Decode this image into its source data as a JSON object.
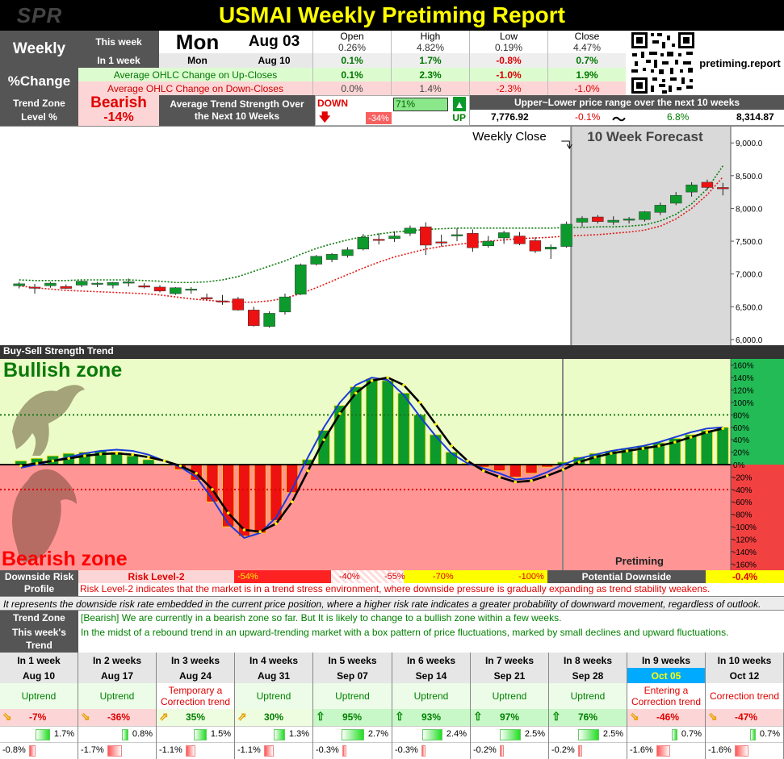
{
  "title": "USMAI Weekly Pretiming Report",
  "logo": "SPR",
  "header": {
    "weekly_label": "Weekly",
    "pct_change_label": "%Change",
    "this_week_label": "This week",
    "in1week_label": "In 1 week",
    "day": "Mon",
    "date": "Aug 03",
    "next_day": "Mon",
    "next_date": "Aug 10",
    "cols": [
      "Open",
      "High",
      "Low",
      "Close"
    ],
    "this_week_values": [
      "0.26%",
      "4.82%",
      "0.19%",
      "4.47%"
    ],
    "in1week_values": [
      "0.1%",
      "1.7%",
      "-0.8%",
      "0.7%"
    ],
    "up_label": "Average OHLC Change on Up-Closes",
    "up_values": [
      "0.1%",
      "2.3%",
      "-1.0%",
      "1.9%"
    ],
    "down_label": "Average OHLC Change on Down-Closes",
    "down_values": [
      "0.0%",
      "1.4%",
      "-2.3%",
      "-1.0%"
    ],
    "site": "pretiming.report"
  },
  "trend_zone": {
    "label1": "Trend Zone",
    "label2": "Level %",
    "state": "Bearish",
    "level": "-14%",
    "strength_label": "Average Trend Strength Over the Next 10 Weeks",
    "down_label": "DOWN",
    "down_value": "-34%",
    "up_value": "71%",
    "up_label": "UP",
    "range_label": "Upper~Lower price range over the next 10 weeks",
    "range_low": "7,776.92",
    "range_low_pct": "-0.1%",
    "tilde": "〜",
    "range_high_pct": "6.8%",
    "range_high": "8,314.87"
  },
  "price_chart": {
    "weekly_close_label": "Weekly Close",
    "forecast_label": "10 Week Forecast",
    "y_ticks": [
      "9,000.0",
      "8,500.0",
      "8,000.0",
      "7,500.0",
      "7,000.0",
      "6,500.0",
      "6,000.0"
    ]
  },
  "strength_chart": {
    "section_title": "Buy-Sell Strength Trend",
    "bull_label": "Bullish zone",
    "bear_label": "Bearish zone",
    "brand": "Pretiming",
    "y_ticks": [
      "160%",
      "140%",
      "120%",
      "100%",
      "80%",
      "60%",
      "40%",
      "20%",
      "0%",
      "-20%",
      "-40%",
      "-60%",
      "-80%",
      "-100%",
      "-120%",
      "-140%",
      "-160%"
    ]
  },
  "chart_data": [
    {
      "type": "candlestick",
      "title": "",
      "ylim": [
        5950,
        9150
      ],
      "candles": [
        {
          "o": 6820,
          "h": 6880,
          "l": 6780,
          "c": 6850
        },
        {
          "o": 6800,
          "h": 6850,
          "l": 6700,
          "c": 6790
        },
        {
          "o": 6820,
          "h": 6880,
          "l": 6790,
          "c": 6860
        },
        {
          "o": 6810,
          "h": 6840,
          "l": 6770,
          "c": 6780
        },
        {
          "o": 6830,
          "h": 6900,
          "l": 6800,
          "c": 6890
        },
        {
          "o": 6850,
          "h": 6880,
          "l": 6800,
          "c": 6860
        },
        {
          "o": 6830,
          "h": 6880,
          "l": 6780,
          "c": 6870
        },
        {
          "o": 6860,
          "h": 6930,
          "l": 6810,
          "c": 6880
        },
        {
          "o": 6820,
          "h": 6860,
          "l": 6780,
          "c": 6800
        },
        {
          "o": 6800,
          "h": 6830,
          "l": 6720,
          "c": 6740
        },
        {
          "o": 6700,
          "h": 6800,
          "l": 6680,
          "c": 6790
        },
        {
          "o": 6760,
          "h": 6800,
          "l": 6700,
          "c": 6770
        },
        {
          "o": 6640,
          "h": 6700,
          "l": 6600,
          "c": 6620
        },
        {
          "o": 6590,
          "h": 6680,
          "l": 6530,
          "c": 6580
        },
        {
          "o": 6620,
          "h": 6650,
          "l": 6440,
          "c": 6450
        },
        {
          "o": 6450,
          "h": 6500,
          "l": 6200,
          "c": 6210
        },
        {
          "o": 6200,
          "h": 6430,
          "l": 6180,
          "c": 6400
        },
        {
          "o": 6420,
          "h": 6700,
          "l": 6380,
          "c": 6650
        },
        {
          "o": 6690,
          "h": 7160,
          "l": 6680,
          "c": 7140
        },
        {
          "o": 7150,
          "h": 7290,
          "l": 7130,
          "c": 7270
        },
        {
          "o": 7220,
          "h": 7320,
          "l": 7180,
          "c": 7300
        },
        {
          "o": 7280,
          "h": 7410,
          "l": 7250,
          "c": 7370
        },
        {
          "o": 7380,
          "h": 7610,
          "l": 7360,
          "c": 7560
        },
        {
          "o": 7530,
          "h": 7620,
          "l": 7450,
          "c": 7520
        },
        {
          "o": 7540,
          "h": 7650,
          "l": 7490,
          "c": 7580
        },
        {
          "o": 7620,
          "h": 7740,
          "l": 7580,
          "c": 7700
        },
        {
          "o": 7720,
          "h": 7790,
          "l": 7290,
          "c": 7440
        },
        {
          "o": 7490,
          "h": 7600,
          "l": 7420,
          "c": 7480
        },
        {
          "o": 7580,
          "h": 7700,
          "l": 7500,
          "c": 7600
        },
        {
          "o": 7620,
          "h": 7680,
          "l": 7340,
          "c": 7400
        },
        {
          "o": 7430,
          "h": 7580,
          "l": 7400,
          "c": 7500
        },
        {
          "o": 7550,
          "h": 7660,
          "l": 7460,
          "c": 7630
        },
        {
          "o": 7580,
          "h": 7640,
          "l": 7440,
          "c": 7460
        },
        {
          "o": 7510,
          "h": 7560,
          "l": 7320,
          "c": 7350
        },
        {
          "o": 7380,
          "h": 7450,
          "l": 7230,
          "c": 7410
        },
        {
          "o": 7420,
          "h": 7800,
          "l": 7400,
          "c": 7760
        },
        {
          "o": 7790,
          "h": 7880,
          "l": 7720,
          "c": 7850
        },
        {
          "o": 7870,
          "h": 7900,
          "l": 7770,
          "c": 7800
        },
        {
          "o": 7790,
          "h": 7880,
          "l": 7750,
          "c": 7820
        },
        {
          "o": 7820,
          "h": 7870,
          "l": 7770,
          "c": 7840
        },
        {
          "o": 7830,
          "h": 7960,
          "l": 7800,
          "c": 7950
        },
        {
          "o": 7940,
          "h": 8090,
          "l": 7900,
          "c": 8050
        },
        {
          "o": 8080,
          "h": 8250,
          "l": 8050,
          "c": 8200
        },
        {
          "o": 8250,
          "h": 8400,
          "l": 8180,
          "c": 8360
        },
        {
          "o": 8400,
          "h": 8440,
          "l": 8280,
          "c": 8320
        },
        {
          "o": 8320,
          "h": 8390,
          "l": 8200,
          "c": 8300
        }
      ],
      "forecast_start_index": 36,
      "upper_band": [
        6910,
        6900,
        6900,
        6900,
        6910,
        6910,
        6910,
        6910,
        6900,
        6890,
        6870,
        6870,
        6880,
        6910,
        6960,
        7040,
        7120,
        7200,
        7300,
        7390,
        7460,
        7520,
        7570,
        7610,
        7640,
        7660,
        7680,
        7690,
        7700,
        7700,
        7700,
        7700,
        7700,
        7700,
        7700,
        7710,
        7710,
        7720,
        7720,
        7730,
        7750,
        7810,
        7910,
        8070,
        8300,
        8650
      ],
      "lower_band": [
        6820,
        6790,
        6770,
        6750,
        6740,
        6730,
        6720,
        6710,
        6700,
        6680,
        6650,
        6620,
        6600,
        6580,
        6570,
        6570,
        6590,
        6630,
        6700,
        6790,
        6890,
        6990,
        7090,
        7180,
        7260,
        7320,
        7380,
        7420,
        7450,
        7480,
        7500,
        7520,
        7540,
        7550,
        7560,
        7580,
        7590,
        7600,
        7620,
        7640,
        7670,
        7730,
        7840,
        8000,
        8210,
        8480
      ]
    },
    {
      "type": "bar",
      "title": "Buy-Sell Strength Trend",
      "ylim": [
        -170,
        170
      ],
      "values": [
        6,
        10,
        14,
        18,
        20,
        22,
        20,
        14,
        8,
        0,
        -8,
        -25,
        -60,
        -100,
        -115,
        -110,
        -90,
        -45,
        8,
        55,
        95,
        125,
        138,
        135,
        115,
        80,
        48,
        20,
        2,
        -4,
        -10,
        -20,
        -14,
        -4,
        4,
        12,
        18,
        22,
        26,
        30,
        35,
        42,
        48,
        55,
        60
      ],
      "series": [
        {
          "name": "",
          "values": [
            -5,
            0,
            6,
            12,
            18,
            22,
            24,
            22,
            16,
            6,
            -4,
            -20,
            -55,
            -95,
            -118,
            -110,
            -85,
            -40,
            12,
            60,
            100,
            128,
            140,
            136,
            112,
            78,
            46,
            18,
            2,
            -6,
            -14,
            -24,
            -22,
            -12,
            0,
            10,
            16,
            22,
            26,
            30,
            36,
            44,
            52,
            58,
            60
          ]
        },
        {
          "name": "",
          "values": [
            -2,
            2,
            6,
            10,
            14,
            17,
            18,
            16,
            12,
            6,
            -2,
            -14,
            -40,
            -78,
            -105,
            -108,
            -95,
            -60,
            -10,
            40,
            82,
            115,
            135,
            140,
            128,
            100,
            65,
            30,
            6,
            -10,
            -20,
            -28,
            -26,
            -18,
            -8,
            4,
            12,
            18,
            22,
            26,
            30,
            36,
            44,
            52,
            58
          ]
        }
      ],
      "hlines": [
        80,
        -40
      ]
    }
  ],
  "risk": {
    "label": "Downside Risk Profile",
    "level": "Risk Level-2",
    "markers": [
      "-54%",
      "-40%",
      "-55%",
      "-70%",
      "-100%"
    ],
    "potential_label": "Potential Downside",
    "potential_value": "-0.4%",
    "desc": "Risk Level-2 indicates that the market is in a trend stress environment, where downside pressure is gradually expanding as trend stability weakens.",
    "note": "It represents the downside risk rate embedded in the current price position, where a higher risk rate indicates a greater probability of downward movement, regardless of outlook."
  },
  "commentary": {
    "tz_label": "Trend Zone",
    "tz_text": "[Bearish] We are currently in a bearish zone so far. But It is likely to change to a bullish zone within a few weeks.",
    "tw_label": "This week's Trend",
    "tw_text": "In the midst of a rebound trend in an upward-trending market with a box pattern of price fluctuations, marked by small declines and upward fluctuations."
  },
  "forecast": [
    {
      "week": "In 1 week",
      "date": "Aug 10",
      "trend": "Uptrend",
      "strength": "-7%",
      "up": "1.7%",
      "up_frac": 0.18,
      "down": "-0.8%",
      "down_frac": 0.08,
      "tone": "down"
    },
    {
      "week": "In 2 weeks",
      "date": "Aug 17",
      "trend": "Uptrend",
      "strength": "-36%",
      "up": "0.8%",
      "up_frac": 0.08,
      "down": "-1.7%",
      "down_frac": 0.18,
      "tone": "down"
    },
    {
      "week": "In 3 weeks",
      "date": "Aug 24",
      "trend": "Temporary a Correction trend",
      "strength": "35%",
      "up": "1.5%",
      "up_frac": 0.16,
      "down": "-1.1%",
      "down_frac": 0.12,
      "tone": "mid"
    },
    {
      "week": "In 4 weeks",
      "date": "Aug 31",
      "trend": "Uptrend",
      "strength": "30%",
      "up": "1.3%",
      "up_frac": 0.14,
      "down": "-1.1%",
      "down_frac": 0.12,
      "tone": "mid"
    },
    {
      "week": "In 5 weeks",
      "date": "Sep 07",
      "trend": "Uptrend",
      "strength": "95%",
      "up": "2.7%",
      "up_frac": 0.28,
      "down": "-0.3%",
      "down_frac": 0.03,
      "tone": "up"
    },
    {
      "week": "In 6 weeks",
      "date": "Sep 14",
      "trend": "Uptrend",
      "strength": "93%",
      "up": "2.4%",
      "up_frac": 0.25,
      "down": "-0.3%",
      "down_frac": 0.03,
      "tone": "up"
    },
    {
      "week": "In 7 weeks",
      "date": "Sep 21",
      "trend": "Uptrend",
      "strength": "97%",
      "up": "2.5%",
      "up_frac": 0.26,
      "down": "-0.2%",
      "down_frac": 0.02,
      "tone": "up"
    },
    {
      "week": "In 8 weeks",
      "date": "Sep 28",
      "trend": "Uptrend",
      "strength": "76%",
      "up": "2.5%",
      "up_frac": 0.26,
      "down": "-0.2%",
      "down_frac": 0.02,
      "tone": "up"
    },
    {
      "week": "In 9 weeks",
      "date": "Oct 05",
      "trend": "Entering a Correction trend",
      "strength": "-46%",
      "up": "0.7%",
      "up_frac": 0.07,
      "down": "-1.6%",
      "down_frac": 0.17,
      "tone": "down",
      "highlight": true
    },
    {
      "week": "In 10 weeks",
      "date": "Oct 12",
      "trend": "Correction trend",
      "strength": "-47%",
      "up": "0.7%",
      "up_frac": 0.07,
      "down": "-1.6%",
      "down_frac": 0.17,
      "tone": "down"
    }
  ],
  "colors": {
    "bull": "#09a329",
    "bear": "#ee1111",
    "bull_bg": "#ecfcc8",
    "bear_bg": "#ff9595"
  }
}
